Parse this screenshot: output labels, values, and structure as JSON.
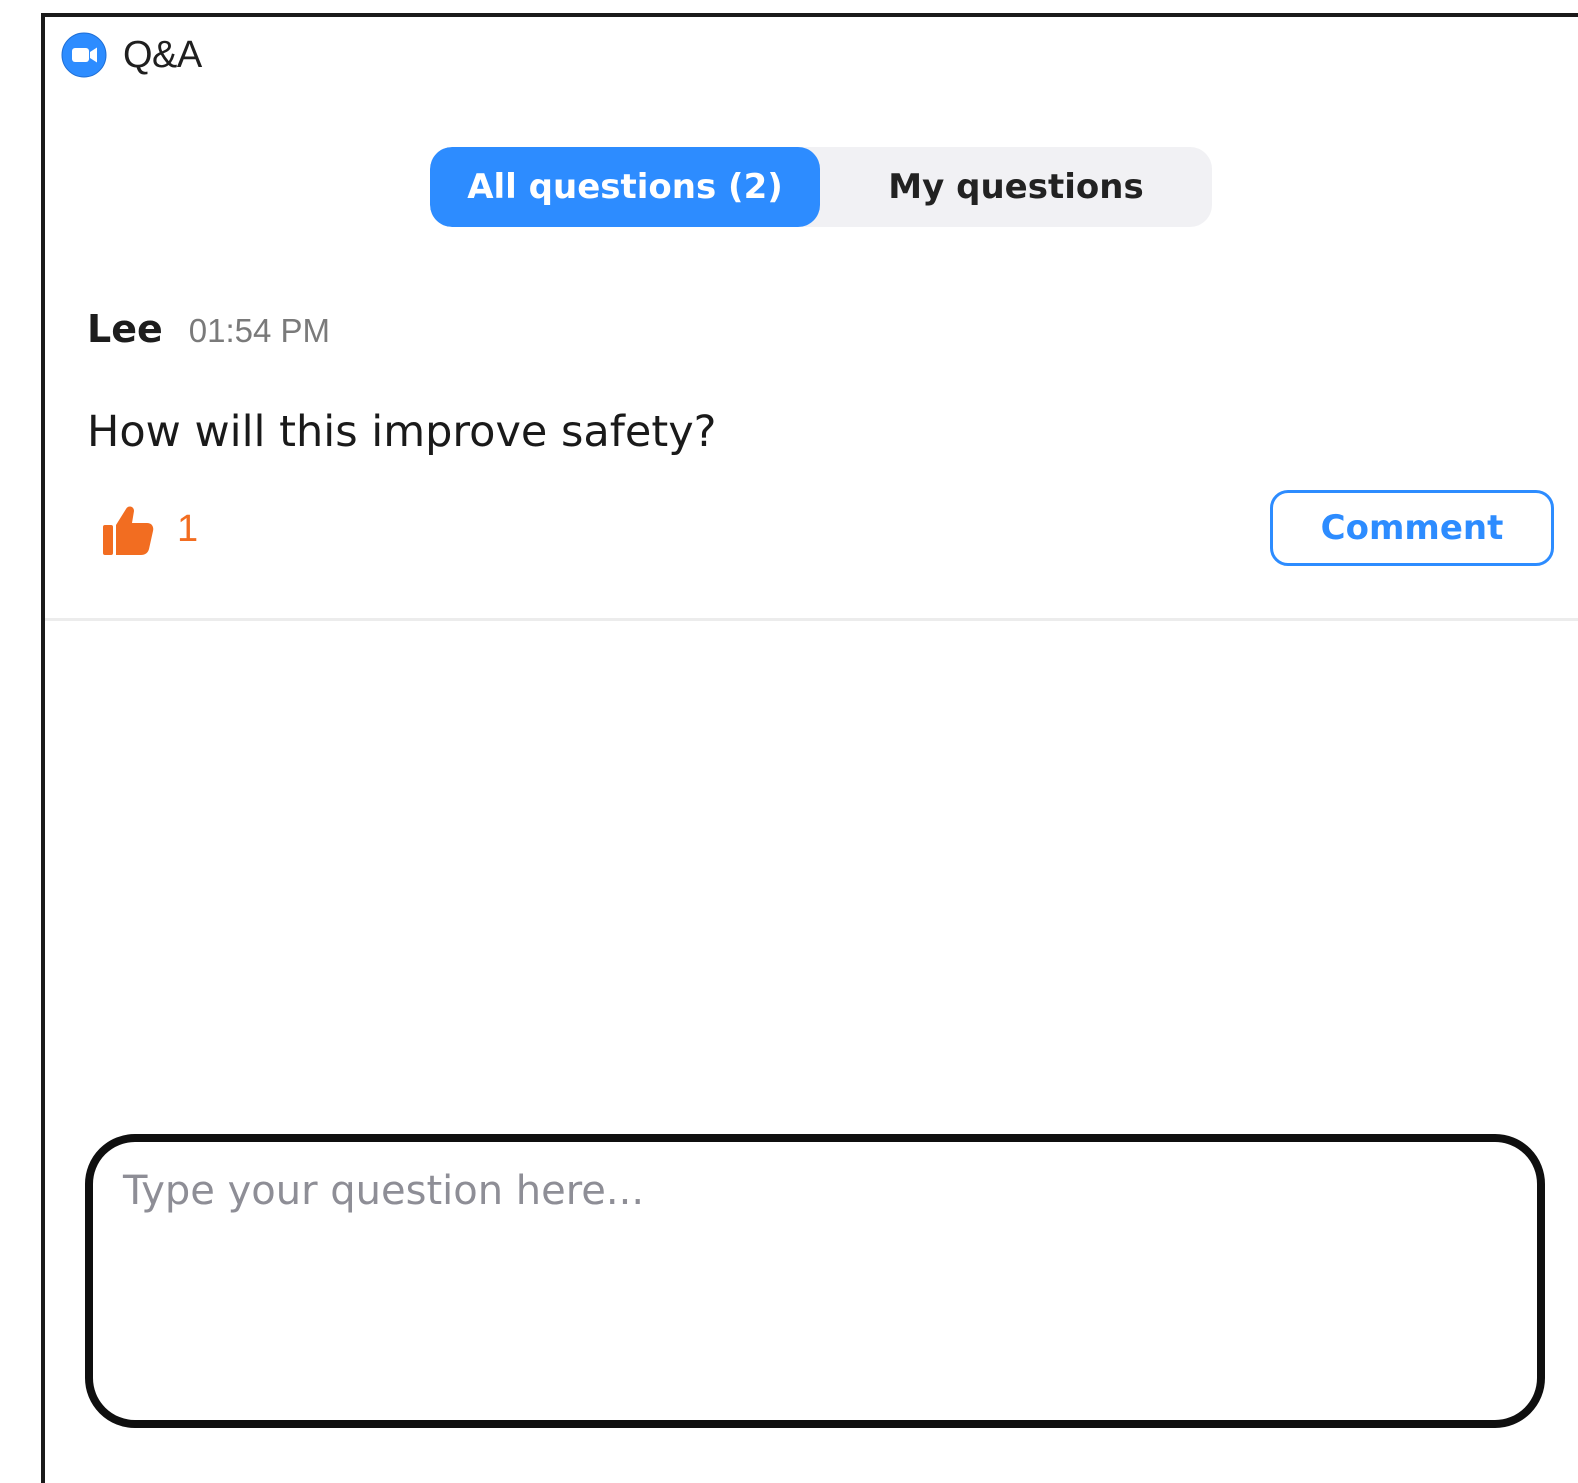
{
  "window": {
    "title": "Q&A",
    "app_icon": "zoom-camera-icon"
  },
  "tabs": [
    {
      "label": "All questions (2)",
      "selected": true
    },
    {
      "label": "My questions",
      "selected": false
    }
  ],
  "question": {
    "author": "Lee",
    "time": "01:54 PM",
    "text": "How will this improve safety?",
    "upvote_icon": "thumbs-up-icon",
    "upvote_count": "1",
    "comment_label": "Comment"
  },
  "composer": {
    "placeholder": "Type your question here...",
    "value": ""
  },
  "colors": {
    "accent": "#2d8cff",
    "upvote": "#f26d21",
    "tab_background": "#f1f1f4"
  }
}
